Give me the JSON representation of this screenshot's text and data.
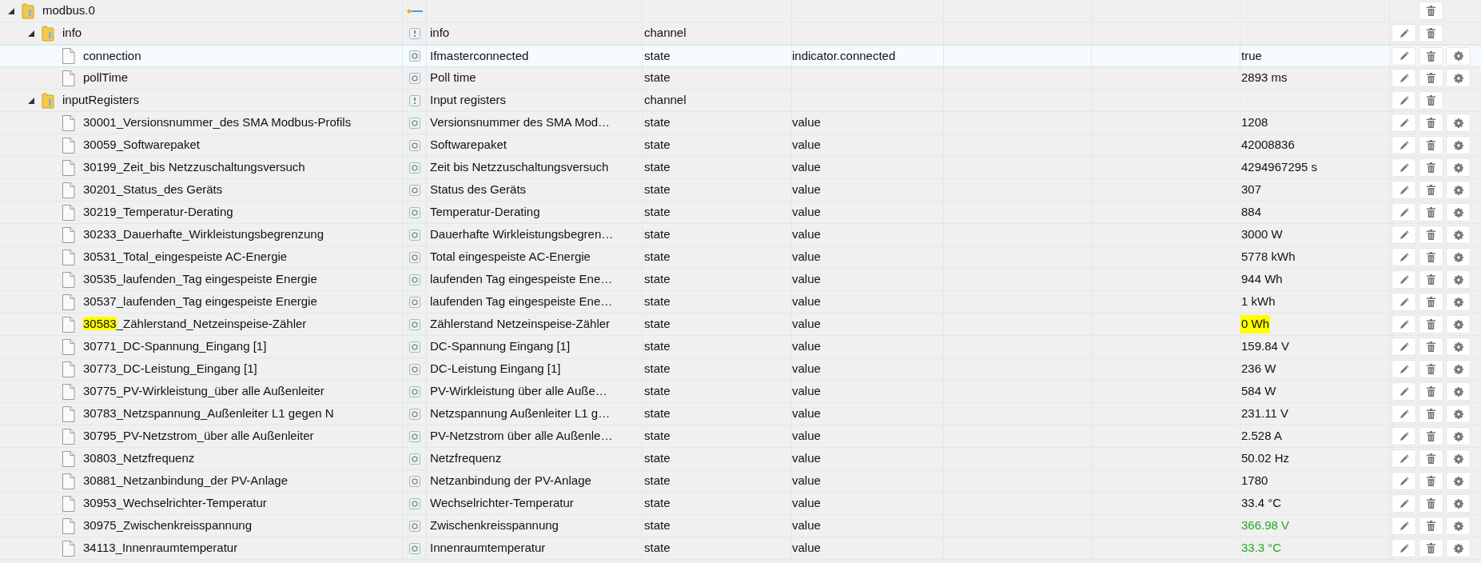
{
  "tree": [
    {
      "id": "modbus.0",
      "kind": "adapter",
      "expanded": true,
      "selected": false,
      "buttons": [
        {
          "kind": "delete"
        }
      ],
      "children": [
        {
          "id": "info",
          "kind": "channel",
          "expanded": true,
          "selected": false,
          "name": "info",
          "type": "channel",
          "buttons": [
            {
              "kind": "edit"
            },
            {
              "kind": "delete"
            }
          ],
          "children": [
            {
              "id": "connection",
              "kind": "state",
              "selected": true,
              "name": "Ifmasterconnected",
              "type": "state",
              "role": "indicator.connected",
              "value": "true",
              "buttons": [
                {
                  "kind": "edit"
                },
                {
                  "kind": "delete"
                },
                {
                  "kind": "settings"
                }
              ]
            },
            {
              "id": "pollTime",
              "kind": "state",
              "selected": false,
              "name": "Poll time",
              "type": "state",
              "value": "2893 ms",
              "buttons": [
                {
                  "kind": "edit"
                },
                {
                  "kind": "delete"
                },
                {
                  "kind": "settings"
                }
              ]
            }
          ]
        },
        {
          "id": "inputRegisters",
          "kind": "channel",
          "expanded": true,
          "selected": false,
          "name": "Input registers",
          "type": "channel",
          "buttons": [
            {
              "kind": "edit"
            },
            {
              "kind": "delete"
            }
          ],
          "children": [
            {
              "id": "30001_Versionsnummer_des SMA Modbus-Profils",
              "kind": "state",
              "selected": false,
              "name": "Versionsnummer des SMA Mod…",
              "type": "state",
              "role": "value",
              "value": "1208",
              "buttons": [
                {
                  "kind": "edit"
                },
                {
                  "kind": "delete"
                },
                {
                  "kind": "settings"
                }
              ]
            },
            {
              "id": "30059_Softwarepaket",
              "kind": "state",
              "selected": false,
              "name": "Softwarepaket",
              "type": "state",
              "role": "value",
              "value": "42008836",
              "buttons": [
                {
                  "kind": "edit"
                },
                {
                  "kind": "delete"
                },
                {
                  "kind": "settings"
                }
              ]
            },
            {
              "id": "30199_Zeit_bis Netzzuschaltungsversuch",
              "kind": "state",
              "selected": false,
              "name": "Zeit bis Netzzuschaltungsversuch",
              "type": "state",
              "role": "value",
              "value": "4294967295 s",
              "buttons": [
                {
                  "kind": "edit"
                },
                {
                  "kind": "delete"
                },
                {
                  "kind": "settings"
                }
              ]
            },
            {
              "id": "30201_Status_des Geräts",
              "kind": "state",
              "selected": false,
              "name": "Status des Geräts",
              "type": "state",
              "role": "value",
              "value": "307",
              "buttons": [
                {
                  "kind": "edit"
                },
                {
                  "kind": "delete"
                },
                {
                  "kind": "settings"
                }
              ]
            },
            {
              "id": "30219_Temperatur-Derating",
              "kind": "state",
              "selected": false,
              "name": "Temperatur-Derating",
              "type": "state",
              "role": "value",
              "value": "884",
              "buttons": [
                {
                  "kind": "edit"
                },
                {
                  "kind": "delete"
                },
                {
                  "kind": "settings"
                }
              ]
            },
            {
              "id": "30233_Dauerhafte_Wirkleistungsbegrenzung",
              "kind": "state",
              "selected": false,
              "name": "Dauerhafte Wirkleistungsbegren…",
              "type": "state",
              "role": "value",
              "value": "3000 W",
              "buttons": [
                {
                  "kind": "edit"
                },
                {
                  "kind": "delete"
                },
                {
                  "kind": "settings"
                }
              ]
            },
            {
              "id": "30531_Total_eingespeiste AC-Energie",
              "kind": "state",
              "selected": false,
              "name": "Total eingespeiste AC-Energie",
              "type": "state",
              "role": "value",
              "value": "5778 kWh",
              "buttons": [
                {
                  "kind": "edit"
                },
                {
                  "kind": "delete"
                },
                {
                  "kind": "settings"
                }
              ]
            },
            {
              "id": "30535_laufenden_Tag eingespeiste Energie",
              "kind": "state",
              "selected": false,
              "name": "laufenden Tag eingespeiste Ene…",
              "type": "state",
              "role": "value",
              "value": "944 Wh",
              "buttons": [
                {
                  "kind": "edit"
                },
                {
                  "kind": "delete"
                },
                {
                  "kind": "settings"
                }
              ]
            },
            {
              "id": "30537_laufenden_Tag eingespeiste Energie",
              "kind": "state",
              "selected": false,
              "name": "laufenden Tag eingespeiste Ene…",
              "type": "state",
              "role": "value",
              "value": "1 kWh",
              "buttons": [
                {
                  "kind": "edit"
                },
                {
                  "kind": "delete"
                },
                {
                  "kind": "settings"
                }
              ]
            },
            {
              "id_marked": "30583",
              "id": "_Zählerstand_Netzeinspeise-Zähler",
              "kind": "state",
              "selected": false,
              "name": "Zählerstand Netzeinspeise-Zähler",
              "type": "state",
              "role": "value",
              "value": "0 Wh",
              "value_marked": true,
              "buttons": [
                {
                  "kind": "edit"
                },
                {
                  "kind": "delete"
                },
                {
                  "kind": "settings"
                }
              ]
            },
            {
              "id": "30771_DC-Spannung_Eingang [1]",
              "kind": "state",
              "selected": false,
              "name": "DC-Spannung Eingang [1]",
              "type": "state",
              "role": "value",
              "value": "159.84 V",
              "buttons": [
                {
                  "kind": "edit"
                },
                {
                  "kind": "delete"
                },
                {
                  "kind": "settings"
                }
              ]
            },
            {
              "id": "30773_DC-Leistung_Eingang [1]",
              "kind": "state",
              "selected": false,
              "name": "DC-Leistung Eingang [1]",
              "type": "state",
              "role": "value",
              "value": "236 W",
              "buttons": [
                {
                  "kind": "edit"
                },
                {
                  "kind": "delete"
                },
                {
                  "kind": "settings"
                }
              ]
            },
            {
              "id": "30775_PV-Wirkleistung_über alle Außenleiter",
              "kind": "state",
              "selected": false,
              "name": "PV-Wirkleistung über alle Auße…",
              "type": "state",
              "role": "value",
              "value": "584 W",
              "buttons": [
                {
                  "kind": "edit"
                },
                {
                  "kind": "delete"
                },
                {
                  "kind": "settings"
                }
              ]
            },
            {
              "id": "30783_Netzspannung_Außenleiter L1 gegen N",
              "kind": "state",
              "selected": false,
              "name": "Netzspannung Außenleiter L1 g…",
              "type": "state",
              "role": "value",
              "value": "231.11 V",
              "buttons": [
                {
                  "kind": "edit"
                },
                {
                  "kind": "delete"
                },
                {
                  "kind": "settings"
                }
              ]
            },
            {
              "id": "30795_PV-Netzstrom_über alle Außenleiter",
              "kind": "state",
              "selected": false,
              "name": "PV-Netzstrom über alle Außenle…",
              "type": "state",
              "role": "value",
              "value": "2.528 A",
              "buttons": [
                {
                  "kind": "edit"
                },
                {
                  "kind": "delete"
                },
                {
                  "kind": "settings"
                }
              ]
            },
            {
              "id": "30803_Netzfrequenz",
              "kind": "state",
              "selected": false,
              "name": "Netzfrequenz",
              "type": "state",
              "role": "value",
              "value": "50.02 Hz",
              "buttons": [
                {
                  "kind": "edit"
                },
                {
                  "kind": "delete"
                },
                {
                  "kind": "settings"
                }
              ]
            },
            {
              "id": "30881_Netzanbindung_der PV-Anlage",
              "kind": "state",
              "selected": false,
              "name": "Netzanbindung der PV-Anlage",
              "type": "state",
              "role": "value",
              "value": "1780",
              "buttons": [
                {
                  "kind": "edit"
                },
                {
                  "kind": "delete"
                },
                {
                  "kind": "settings"
                }
              ]
            },
            {
              "id": "30953_Wechselrichter-Temperatur",
              "kind": "state",
              "selected": false,
              "name": "Wechselrichter-Temperatur",
              "type": "state",
              "role": "value",
              "value": "33.4 °C",
              "buttons": [
                {
                  "kind": "edit"
                },
                {
                  "kind": "delete"
                },
                {
                  "kind": "settings"
                }
              ]
            },
            {
              "id": "30975_Zwischenkreisspannung",
              "kind": "state",
              "selected": false,
              "name": "Zwischenkreisspannung",
              "type": "state",
              "role": "value",
              "value": "366.98 V",
              "color": "#22a822",
              "buttons": [
                {
                  "kind": "edit"
                },
                {
                  "kind": "delete"
                },
                {
                  "kind": "settings"
                }
              ]
            },
            {
              "id": "34113_Innenraumtemperatur",
              "kind": "state",
              "selected": false,
              "name": "Innenraumtemperatur",
              "type": "state",
              "role": "value",
              "value": "33.3 °C",
              "color": "#22a822",
              "buttons": [
                {
                  "kind": "edit"
                },
                {
                  "kind": "delete"
                },
                {
                  "kind": "settings"
                }
              ]
            }
          ]
        }
      ]
    }
  ]
}
